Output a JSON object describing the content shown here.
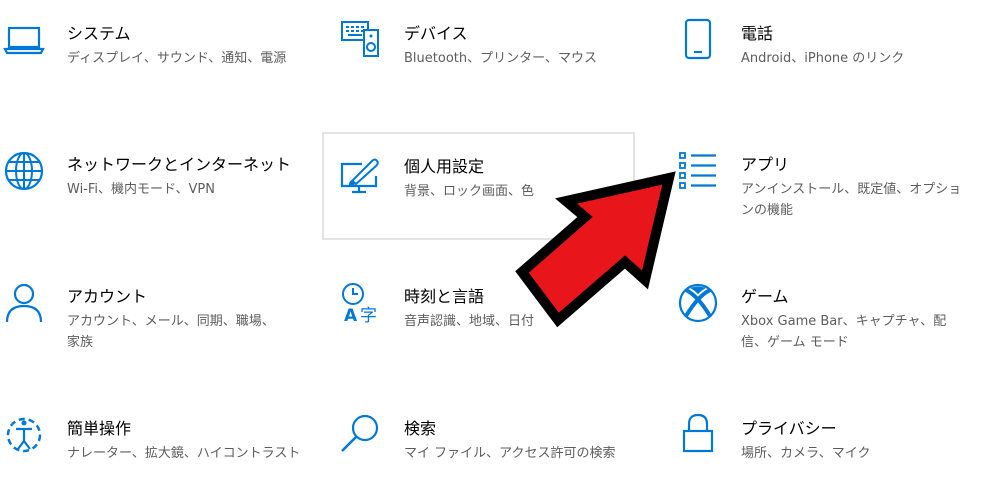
{
  "tiles": {
    "system": {
      "title": "システム",
      "desc": "ディスプレイ、サウンド、通知、電源",
      "icon": "laptop-icon"
    },
    "devices": {
      "title": "デバイス",
      "desc": "Bluetooth、プリンター、マウス",
      "icon": "devices-icon"
    },
    "phone": {
      "title": "電話",
      "desc": "Android、iPhone のリンク",
      "icon": "phone-icon"
    },
    "network": {
      "title": "ネットワークとインターネット",
      "desc": "Wi-Fi、機内モード、VPN",
      "icon": "globe-icon"
    },
    "personal": {
      "title": "個人用設定",
      "desc": "背景、ロック画面、色",
      "icon": "paintbrush-icon"
    },
    "apps": {
      "title": "アプリ",
      "desc": "アンインストール、既定値、オプションの機能",
      "icon": "apps-list-icon"
    },
    "accounts": {
      "title": "アカウント",
      "desc": "アカウント、メール、同期、職場、家族",
      "icon": "person-icon"
    },
    "time": {
      "title": "時刻と言語",
      "desc": "音声認識、地域、日付",
      "icon": "time-language-icon"
    },
    "gaming": {
      "title": "ゲーム",
      "desc": "Xbox Game Bar、キャプチャ、配信、ゲーム モード",
      "icon": "xbox-icon"
    },
    "ease": {
      "title": "簡単操作",
      "desc": "ナレーター、拡大鏡、ハイコントラスト",
      "icon": "ease-of-access-icon"
    },
    "search": {
      "title": "検索",
      "desc": "マイ ファイル、アクセス許可の検索",
      "icon": "search-icon"
    },
    "privacy": {
      "title": "プライバシー",
      "desc": "場所、カメラ、マイク",
      "icon": "lock-icon"
    }
  },
  "colors": {
    "accent": "#0078d7",
    "arrow_fill": "#e8161b",
    "arrow_outline": "#000000"
  }
}
